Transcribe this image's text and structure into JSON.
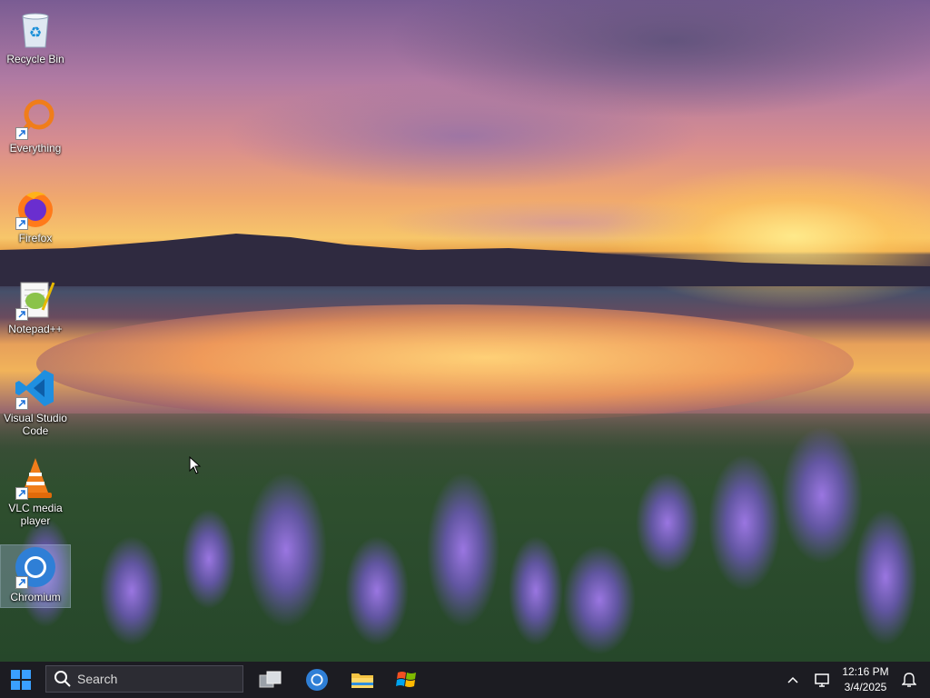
{
  "desktop": {
    "icons": [
      {
        "label": "Recycle Bin",
        "icon": "recycle-bin-icon"
      },
      {
        "label": "Everything",
        "icon": "everything-search-icon"
      },
      {
        "label": "Firefox",
        "icon": "firefox-icon"
      },
      {
        "label": "Notepad++",
        "icon": "notepad-plus-plus-icon"
      },
      {
        "label": "Visual Studio Code",
        "icon": "vscode-icon"
      },
      {
        "label": "VLC media player",
        "icon": "vlc-icon"
      },
      {
        "label": "Chromium",
        "icon": "chromium-icon"
      }
    ],
    "selected_icon": "Chromium"
  },
  "taskbar": {
    "search_placeholder": "Search",
    "pinned": [
      "task-view-icon",
      "chromium-icon",
      "file-explorer-icon",
      "windows-flag-icon"
    ],
    "clock": {
      "time": "12:16 PM",
      "date": "3/4/2025"
    },
    "tray_icons": [
      "chevron-up-icon",
      "network-icon",
      "notification-icon"
    ]
  },
  "colors": {
    "taskbar_bg": "#1c1c22",
    "accent": "#0078d4"
  }
}
